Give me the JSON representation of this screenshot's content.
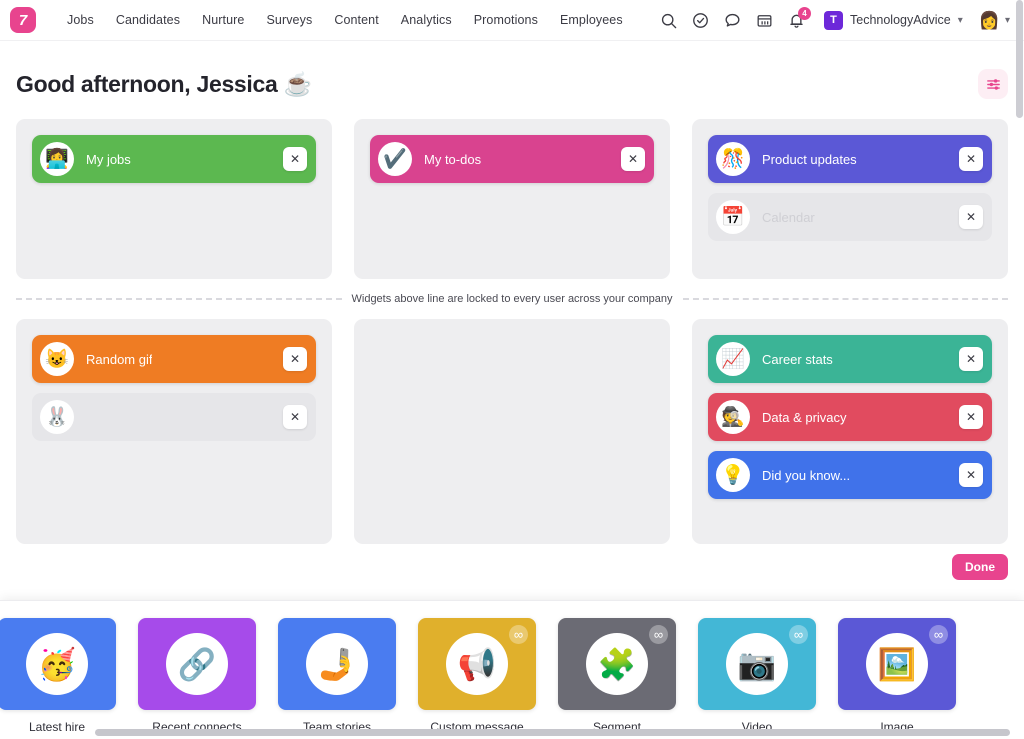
{
  "topbar": {
    "logo_text": "7",
    "logo_color": "#e8448e",
    "nav_items": [
      {
        "label": "Jobs"
      },
      {
        "label": "Candidates"
      },
      {
        "label": "Nurture"
      },
      {
        "label": "Surveys"
      },
      {
        "label": "Content"
      },
      {
        "label": "Analytics"
      },
      {
        "label": "Promotions"
      },
      {
        "label": "Employees"
      }
    ],
    "icons": [
      "search-icon",
      "check-circle-icon",
      "chat-bubble-icon",
      "calendar-icon",
      "bell-icon"
    ],
    "notification_count": "4",
    "org": {
      "initial": "T",
      "name": "TechnologyAdvice",
      "tile_color": "#6d28d9"
    },
    "avatar_emoji": "👩"
  },
  "header": {
    "greeting": "Good afternoon, Jessica ☕",
    "settings_icon": "sliders-icon"
  },
  "board": {
    "divider_text": "Widgets above line are locked to every user across your company",
    "done_label": "Done",
    "done_color": "#e8448e",
    "locked_row": [
      {
        "zone": "locked-left",
        "widgets": [
          {
            "label": "My jobs",
            "emoji": "👩‍💻",
            "color": "#5cb850",
            "ghost": false
          }
        ]
      },
      {
        "zone": "locked-middle",
        "widgets": [
          {
            "label": "My to-dos",
            "emoji": "✔️",
            "color": "#d9438f",
            "ghost": false
          }
        ]
      },
      {
        "zone": "locked-right",
        "widgets": [
          {
            "label": "Product updates",
            "emoji": "🎊",
            "color": "#5b58d6",
            "ghost": false
          },
          {
            "label": "Calendar",
            "emoji": "📅",
            "color": "#e6e6e9",
            "ghost": true
          }
        ]
      }
    ],
    "free_row": [
      {
        "zone": "free-left",
        "widgets": [
          {
            "label": "Random gif",
            "emoji": "😺",
            "color": "#ef7c23",
            "ghost": false
          },
          {
            "label": "",
            "emoji": "🐰",
            "color": "#e6e6e9",
            "ghost": true
          }
        ]
      },
      {
        "zone": "free-middle",
        "widgets": []
      },
      {
        "zone": "free-right",
        "widgets": [
          {
            "label": "Career stats",
            "emoji": "📈",
            "color": "#3bb496",
            "ghost": false
          },
          {
            "label": "Data & privacy",
            "emoji": "🕵️",
            "color": "#e14b5f",
            "ghost": false
          },
          {
            "label": "Did you know...",
            "emoji": "💡",
            "color": "#4072ea",
            "ghost": false
          }
        ]
      }
    ]
  },
  "tray": {
    "items": [
      {
        "label": "",
        "emoji": "",
        "color": "#5cb850",
        "infinite": false,
        "clipped": true
      },
      {
        "label": "Latest hire",
        "emoji": "🥳",
        "color": "#4a7cf0",
        "infinite": false,
        "clipped": false
      },
      {
        "label": "Recent connects",
        "emoji": "🔗",
        "color": "#a64bea",
        "infinite": false,
        "clipped": false
      },
      {
        "label": "Team stories",
        "emoji": "🤳",
        "color": "#4a7cf0",
        "infinite": false,
        "clipped": false
      },
      {
        "label": "Custom message",
        "emoji": "📢",
        "color": "#e0b02c",
        "infinite": true,
        "clipped": false
      },
      {
        "label": "Segment",
        "emoji": "🧩",
        "color": "#6b6b74",
        "infinite": true,
        "clipped": false
      },
      {
        "label": "Video",
        "emoji": "📷",
        "color": "#43b7d6",
        "infinite": true,
        "clipped": false
      },
      {
        "label": "Image",
        "emoji": "🖼️",
        "color": "#5b58d6",
        "infinite": true,
        "clipped": false
      }
    ],
    "infinite_symbol": "∞"
  }
}
